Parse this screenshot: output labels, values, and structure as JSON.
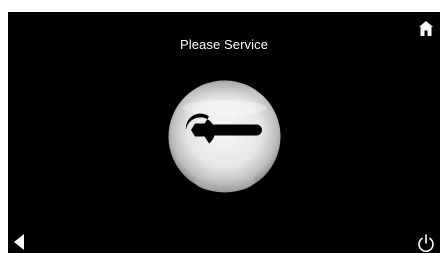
{
  "screen": {
    "title": "Please Service",
    "background_color": "#000000",
    "text_color": "#ffffff"
  },
  "icons": {
    "home": "home-icon",
    "back": "back-arrow-icon",
    "power": "power-icon",
    "service": "wrench-icon"
  }
}
